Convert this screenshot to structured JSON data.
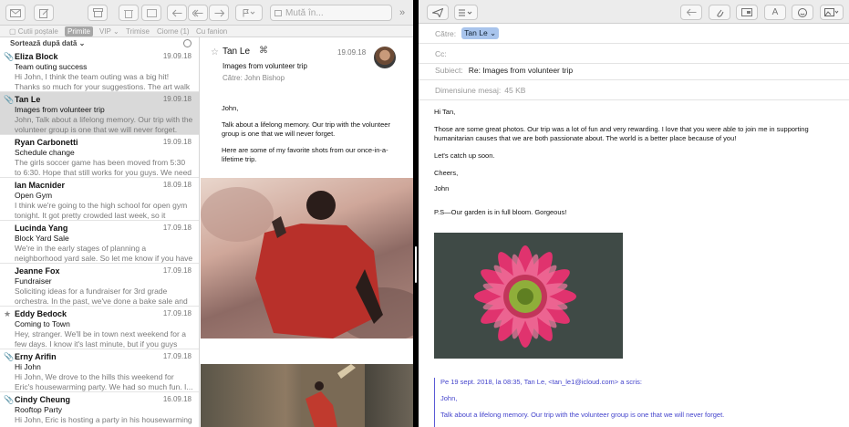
{
  "left": {
    "toolbar": {
      "search_placeholder": "Mută în...",
      "overflow_icon": "chevron-double-right-icon"
    },
    "favorites": {
      "mailboxes": "Cutii poștale",
      "inbox": "Primite",
      "vip": "VIP",
      "sent": "Trimise",
      "drafts": "Ciorne (1)",
      "flagged": "Cu fanion"
    },
    "sort_label": "Sortează după dată",
    "messages": [
      {
        "sender": "Eliza Block",
        "date": "19.09.18",
        "subject": "Team outing success",
        "preview": "Hi John, I think the team outing was a big hit! Thanks so much for your suggestions. The art walk was a great...",
        "mark": "📎"
      },
      {
        "sender": "Tan Le",
        "date": "19.09.18",
        "subject": "Images from volunteer trip",
        "preview": "John, Talk about a lifelong memory. Our trip with the volunteer group is one that we will never forget. Here...",
        "mark": "📎"
      },
      {
        "sender": "Ryan Carbonetti",
        "date": "19.09.18",
        "subject": "Schedule change",
        "preview": "The girls soccer game has been moved from 5:30 to 6:30. Hope that still works for you guys. We need our...",
        "mark": ""
      },
      {
        "sender": "Ian Macnider",
        "date": "18.09.18",
        "subject": "Open Gym",
        "preview": "I think we're going to the high school for open gym tonight. It got pretty crowded last week, so it you're...",
        "mark": ""
      },
      {
        "sender": "Lucinda Yang",
        "date": "17.09.18",
        "subject": "Block Yard Sale",
        "preview": "We're in the early stages of planning a neighborhood yard sale. So let me know if you have anything you...",
        "mark": ""
      },
      {
        "sender": "Jeanne Fox",
        "date": "17.09.18",
        "subject": "Fundraiser",
        "preview": "Soliciting ideas for a fundraiser for 3rd grade orchestra. In the past, we've done a bake sale and a car...",
        "mark": ""
      },
      {
        "sender": "Eddy Bedock",
        "date": "17.09.18",
        "subject": "Coming to Town",
        "preview": "Hey, stranger. We'll be in town next weekend for a few days. I know it's last minute, but if you guys are...",
        "mark": "★"
      },
      {
        "sender": "Erny Arifin",
        "date": "17.09.18",
        "subject": "Hi John",
        "preview": "Hi John, We drove to the hills this weekend for Eric's housewarming party. We had so much fun. I...",
        "mark": "📎"
      },
      {
        "sender": "Cindy Cheung",
        "date": "16.09.18",
        "subject": "Rooftop Party",
        "preview": "Hi John, Eric is hosting a party in his housewarming party. It was pretty fantastic. Need to...",
        "mark": "📎"
      }
    ],
    "preview": {
      "from": "Tan Le",
      "date": "19.09.18",
      "subject": "Images from volunteer trip",
      "to_label": "Către:",
      "to_value": "John Bishop",
      "body": [
        "John,",
        "Talk about a lifelong memory. Our trip with the volunteer group is one that we will never forget.",
        "Here are some of my favorite shots from our once-in-a-lifetime trip."
      ]
    }
  },
  "right": {
    "to_label": "Către:",
    "to_value": "Tan Le",
    "cc_label": "Cc:",
    "subject_label": "Subiect:",
    "subject_value": "Re: Images from volunteer trip",
    "size_label": "Dimensiune mesaj:",
    "size_value": "45 KB",
    "body": [
      "Hi Tan,",
      "Those are some great photos. Our trip was a lot of fun and very rewarding. I love that you were able to join me in supporting humanitarian causes that we are both passionate about. The world is a better place because of you!",
      "Let's catch up soon.",
      "Cheers,",
      "John",
      "P.S—Our garden is in full bloom. Gorgeous!"
    ],
    "quote_header": "Pe 19 sept. 2018, la 08:35, Tan Le, <tan_le1@icloud.com> a scris:",
    "quote_lines": [
      "John,",
      "Talk about a lifelong memory. Our trip with the volunteer group is one that we will never forget."
    ],
    "format_letter": "A"
  }
}
